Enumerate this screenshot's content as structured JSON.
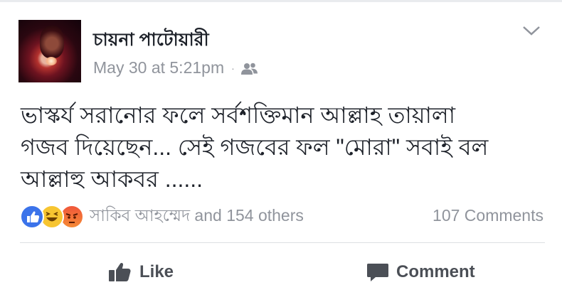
{
  "post": {
    "author_name": "চায়না পাটোয়ারী",
    "timestamp": "May 30 at 5:21pm",
    "separator": "·",
    "audience_icon": "friends-icon",
    "options_icon": "chevron-down-icon",
    "text_lines": [
      "ভাস্কর্য সরানোর ফলে সর্বশক্তিমান আল্লাহ তায়ালা",
      "গজব দিয়েছেন...  সেই গজবের ফল \"মোরা\" সবাই বল",
      "আল্লাহু আকবর ......"
    ]
  },
  "reactions": {
    "icons": [
      "like-reaction-icon",
      "haha-reaction-icon",
      "angry-reaction-icon"
    ],
    "summary": "সাকিব আহম্মেদ and 154 others",
    "comments_count": "107 Comments"
  },
  "actions": {
    "like_label": "Like",
    "comment_label": "Comment"
  },
  "colors": {
    "text_primary": "#1d2129",
    "text_secondary": "#90949c",
    "action_text": "#4b4f56",
    "like_blue": "#3b73ea",
    "haha_yellow": "#f7c531",
    "angry_orange": "#f0573a"
  }
}
